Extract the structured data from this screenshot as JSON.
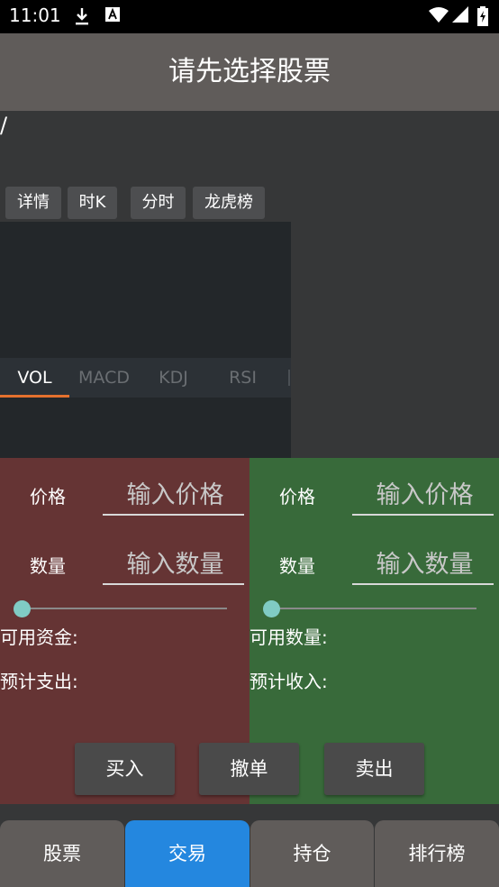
{
  "status_bar": {
    "time": "11:01",
    "icons": [
      "download-icon",
      "a-notification-icon",
      "wifi-icon",
      "signal-icon",
      "battery-icon"
    ]
  },
  "header": {
    "title": "请先选择股票",
    "subtitle": "/"
  },
  "tabs": [
    {
      "label": "详情"
    },
    {
      "label": "时K"
    },
    {
      "label": "分时"
    },
    {
      "label": "龙虎榜"
    }
  ],
  "indicators": {
    "items": [
      "VOL",
      "MACD",
      "KDJ",
      "RSI"
    ],
    "active": "VOL"
  },
  "buy": {
    "price_label": "价格",
    "price_placeholder": "输入价格",
    "qty_label": "数量",
    "qty_placeholder": "输入数量",
    "slider_value": 0,
    "available_label": "可用资金:",
    "estimate_label": "预计支出:"
  },
  "sell": {
    "price_label": "价格",
    "price_placeholder": "输入价格",
    "qty_label": "数量",
    "qty_placeholder": "输入数量",
    "slider_value": 0,
    "available_label": "可用数量:",
    "estimate_label": "预计收入:"
  },
  "actions": {
    "buy_label": "买入",
    "cancel_label": "撤单",
    "sell_label": "卖出"
  },
  "bottom_nav": {
    "items": [
      "股票",
      "交易",
      "持仓",
      "排行榜"
    ],
    "active": "交易"
  },
  "colors": {
    "accent": "#2487df",
    "buy_panel": "#653434",
    "sell_panel": "#386a3a",
    "indicator_underline": "#e5712e",
    "slider_thumb": "#80cbc4"
  }
}
